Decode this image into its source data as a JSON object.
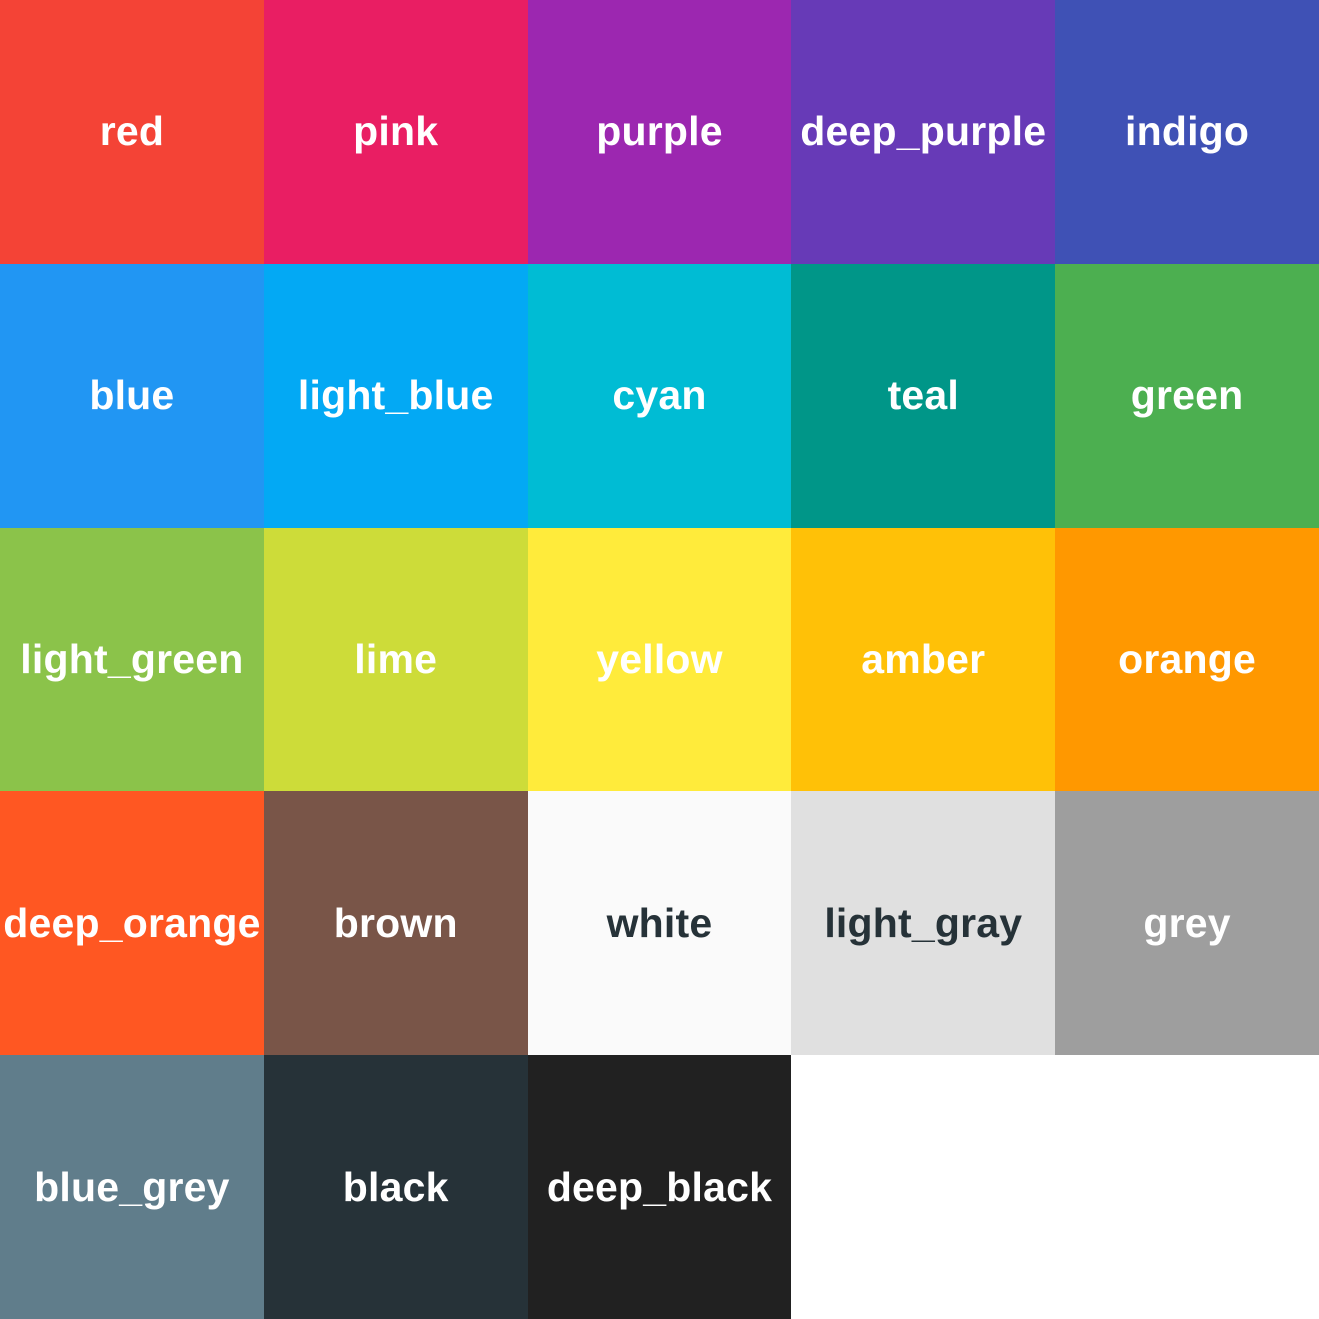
{
  "palette": {
    "swatches": [
      {
        "name": "red",
        "color": "#F44336",
        "text_color": "#FFFFFF"
      },
      {
        "name": "pink",
        "color": "#E91E63",
        "text_color": "#FFFFFF"
      },
      {
        "name": "purple",
        "color": "#9C27B0",
        "text_color": "#FFFFFF"
      },
      {
        "name": "deep_purple",
        "color": "#673AB7",
        "text_color": "#FFFFFF"
      },
      {
        "name": "indigo",
        "color": "#3F51B5",
        "text_color": "#FFFFFF"
      },
      {
        "name": "blue",
        "color": "#2196F3",
        "text_color": "#FFFFFF"
      },
      {
        "name": "light_blue",
        "color": "#03A9F4",
        "text_color": "#FFFFFF"
      },
      {
        "name": "cyan",
        "color": "#00BCD4",
        "text_color": "#FFFFFF"
      },
      {
        "name": "teal",
        "color": "#009688",
        "text_color": "#FFFFFF"
      },
      {
        "name": "green",
        "color": "#4CAF50",
        "text_color": "#FFFFFF"
      },
      {
        "name": "light_green",
        "color": "#8BC34A",
        "text_color": "#FFFFFF"
      },
      {
        "name": "lime",
        "color": "#CDDC39",
        "text_color": "#FFFFFF"
      },
      {
        "name": "yellow",
        "color": "#FFEB3B",
        "text_color": "#FFFFFF"
      },
      {
        "name": "amber",
        "color": "#FFC107",
        "text_color": "#FFFFFF"
      },
      {
        "name": "orange",
        "color": "#FF9800",
        "text_color": "#FFFFFF"
      },
      {
        "name": "deep_orange",
        "color": "#FF5722",
        "text_color": "#FFFFFF"
      },
      {
        "name": "brown",
        "color": "#795548",
        "text_color": "#FFFFFF"
      },
      {
        "name": "white",
        "color": "#FAFAFA",
        "text_color": "#263238"
      },
      {
        "name": "light_gray",
        "color": "#E0E0E0",
        "text_color": "#263238"
      },
      {
        "name": "grey",
        "color": "#9E9E9E",
        "text_color": "#FFFFFF"
      },
      {
        "name": "blue_grey",
        "color": "#607D8B",
        "text_color": "#FFFFFF"
      },
      {
        "name": "black",
        "color": "#263238",
        "text_color": "#FFFFFF"
      },
      {
        "name": "deep_black",
        "color": "#212121",
        "text_color": "#FFFFFF"
      }
    ]
  }
}
